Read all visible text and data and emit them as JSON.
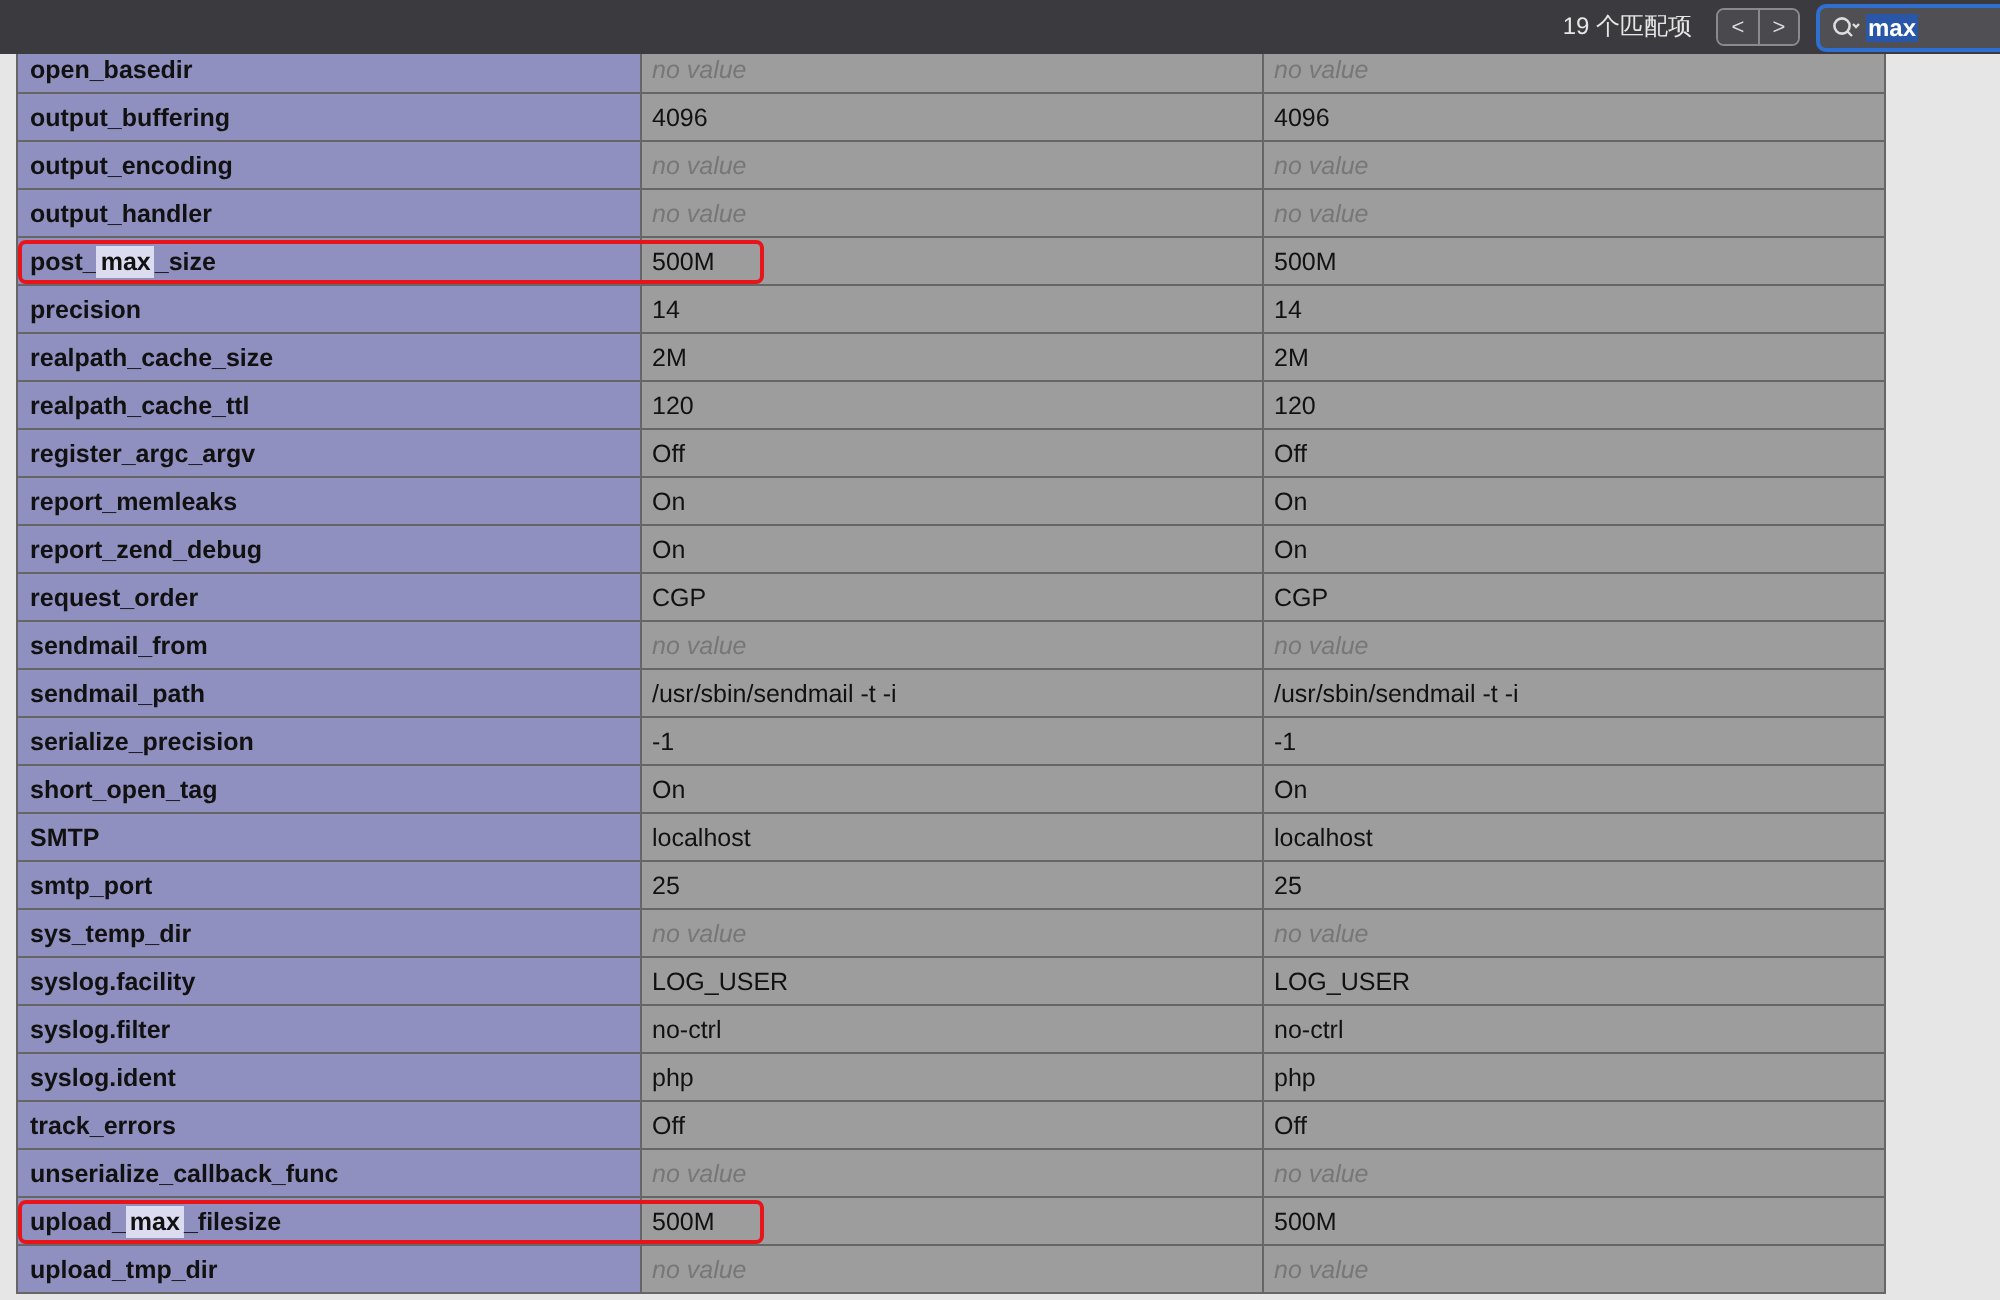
{
  "find_bar": {
    "match_count": "19 个匹配项",
    "prev": "<",
    "next": ">",
    "query": "max"
  },
  "rows": [
    {
      "name": [
        {
          "text": "open_basedir",
          "highlighted": false
        }
      ],
      "outlined": false,
      "values": [
        {
          "kind": "empty",
          "text": "no value"
        },
        {
          "kind": "empty",
          "text": "no value"
        }
      ]
    },
    {
      "name": [
        {
          "text": "output_buffering",
          "highlighted": false
        }
      ],
      "outlined": false,
      "values": [
        {
          "kind": "text",
          "text": "4096"
        },
        {
          "kind": "text",
          "text": "4096"
        }
      ]
    },
    {
      "name": [
        {
          "text": "output_encoding",
          "highlighted": false
        }
      ],
      "outlined": false,
      "values": [
        {
          "kind": "empty",
          "text": "no value"
        },
        {
          "kind": "empty",
          "text": "no value"
        }
      ]
    },
    {
      "name": [
        {
          "text": "output_handler",
          "highlighted": false
        }
      ],
      "outlined": false,
      "values": [
        {
          "kind": "empty",
          "text": "no value"
        },
        {
          "kind": "empty",
          "text": "no value"
        }
      ]
    },
    {
      "name": [
        {
          "text": "post_",
          "highlighted": false
        },
        {
          "text": "max",
          "highlighted": true
        },
        {
          "text": "_size",
          "highlighted": false
        }
      ],
      "outlined": true,
      "values": [
        {
          "kind": "text",
          "text": "500M"
        },
        {
          "kind": "text",
          "text": "500M"
        }
      ]
    },
    {
      "name": [
        {
          "text": "precision",
          "highlighted": false
        }
      ],
      "outlined": false,
      "values": [
        {
          "kind": "text",
          "text": "14"
        },
        {
          "kind": "text",
          "text": "14"
        }
      ]
    },
    {
      "name": [
        {
          "text": "realpath_cache_size",
          "highlighted": false
        }
      ],
      "outlined": false,
      "values": [
        {
          "kind": "text",
          "text": "2M"
        },
        {
          "kind": "text",
          "text": "2M"
        }
      ]
    },
    {
      "name": [
        {
          "text": "realpath_cache_ttl",
          "highlighted": false
        }
      ],
      "outlined": false,
      "values": [
        {
          "kind": "text",
          "text": "120"
        },
        {
          "kind": "text",
          "text": "120"
        }
      ]
    },
    {
      "name": [
        {
          "text": "register_argc_argv",
          "highlighted": false
        }
      ],
      "outlined": false,
      "values": [
        {
          "kind": "text",
          "text": "Off"
        },
        {
          "kind": "text",
          "text": "Off"
        }
      ]
    },
    {
      "name": [
        {
          "text": "report_memleaks",
          "highlighted": false
        }
      ],
      "outlined": false,
      "values": [
        {
          "kind": "text",
          "text": "On"
        },
        {
          "kind": "text",
          "text": "On"
        }
      ]
    },
    {
      "name": [
        {
          "text": "report_zend_debug",
          "highlighted": false
        }
      ],
      "outlined": false,
      "values": [
        {
          "kind": "text",
          "text": "On"
        },
        {
          "kind": "text",
          "text": "On"
        }
      ]
    },
    {
      "name": [
        {
          "text": "request_order",
          "highlighted": false
        }
      ],
      "outlined": false,
      "values": [
        {
          "kind": "text",
          "text": "CGP"
        },
        {
          "kind": "text",
          "text": "CGP"
        }
      ]
    },
    {
      "name": [
        {
          "text": "sendmail_from",
          "highlighted": false
        }
      ],
      "outlined": false,
      "values": [
        {
          "kind": "empty",
          "text": "no value"
        },
        {
          "kind": "empty",
          "text": "no value"
        }
      ]
    },
    {
      "name": [
        {
          "text": "sendmail_path",
          "highlighted": false
        }
      ],
      "outlined": false,
      "values": [
        {
          "kind": "text",
          "text": "/usr/sbin/sendmail -t -i"
        },
        {
          "kind": "text",
          "text": "/usr/sbin/sendmail -t -i"
        }
      ]
    },
    {
      "name": [
        {
          "text": "serialize_precision",
          "highlighted": false
        }
      ],
      "outlined": false,
      "values": [
        {
          "kind": "text",
          "text": "-1"
        },
        {
          "kind": "text",
          "text": "-1"
        }
      ]
    },
    {
      "name": [
        {
          "text": "short_open_tag",
          "highlighted": false
        }
      ],
      "outlined": false,
      "values": [
        {
          "kind": "text",
          "text": "On"
        },
        {
          "kind": "text",
          "text": "On"
        }
      ]
    },
    {
      "name": [
        {
          "text": "SMTP",
          "highlighted": false
        }
      ],
      "outlined": false,
      "values": [
        {
          "kind": "text",
          "text": "localhost"
        },
        {
          "kind": "text",
          "text": "localhost"
        }
      ]
    },
    {
      "name": [
        {
          "text": "smtp_port",
          "highlighted": false
        }
      ],
      "outlined": false,
      "values": [
        {
          "kind": "text",
          "text": "25"
        },
        {
          "kind": "text",
          "text": "25"
        }
      ]
    },
    {
      "name": [
        {
          "text": "sys_temp_dir",
          "highlighted": false
        }
      ],
      "outlined": false,
      "values": [
        {
          "kind": "empty",
          "text": "no value"
        },
        {
          "kind": "empty",
          "text": "no value"
        }
      ]
    },
    {
      "name": [
        {
          "text": "syslog.facility",
          "highlighted": false
        }
      ],
      "outlined": false,
      "values": [
        {
          "kind": "text",
          "text": "LOG_USER"
        },
        {
          "kind": "text",
          "text": "LOG_USER"
        }
      ]
    },
    {
      "name": [
        {
          "text": "syslog.filter",
          "highlighted": false
        }
      ],
      "outlined": false,
      "values": [
        {
          "kind": "text",
          "text": "no-ctrl"
        },
        {
          "kind": "text",
          "text": "no-ctrl"
        }
      ]
    },
    {
      "name": [
        {
          "text": "syslog.ident",
          "highlighted": false
        }
      ],
      "outlined": false,
      "values": [
        {
          "kind": "text",
          "text": "php"
        },
        {
          "kind": "text",
          "text": "php"
        }
      ]
    },
    {
      "name": [
        {
          "text": "track_errors",
          "highlighted": false
        }
      ],
      "outlined": false,
      "values": [
        {
          "kind": "text",
          "text": "Off"
        },
        {
          "kind": "text",
          "text": "Off"
        }
      ]
    },
    {
      "name": [
        {
          "text": "unserialize_callback_func",
          "highlighted": false
        }
      ],
      "outlined": false,
      "values": [
        {
          "kind": "empty",
          "text": "no value"
        },
        {
          "kind": "empty",
          "text": "no value"
        }
      ]
    },
    {
      "name": [
        {
          "text": "upload_",
          "highlighted": false
        },
        {
          "text": "max",
          "highlighted": true
        },
        {
          "text": "_filesize",
          "highlighted": false
        }
      ],
      "outlined": true,
      "values": [
        {
          "kind": "text",
          "text": "500M"
        },
        {
          "kind": "text",
          "text": "500M"
        }
      ]
    },
    {
      "name": [
        {
          "text": "upload_tmp_dir",
          "highlighted": false
        }
      ],
      "outlined": false,
      "values": [
        {
          "kind": "empty",
          "text": "no value"
        },
        {
          "kind": "empty",
          "text": "no value"
        }
      ]
    }
  ]
}
